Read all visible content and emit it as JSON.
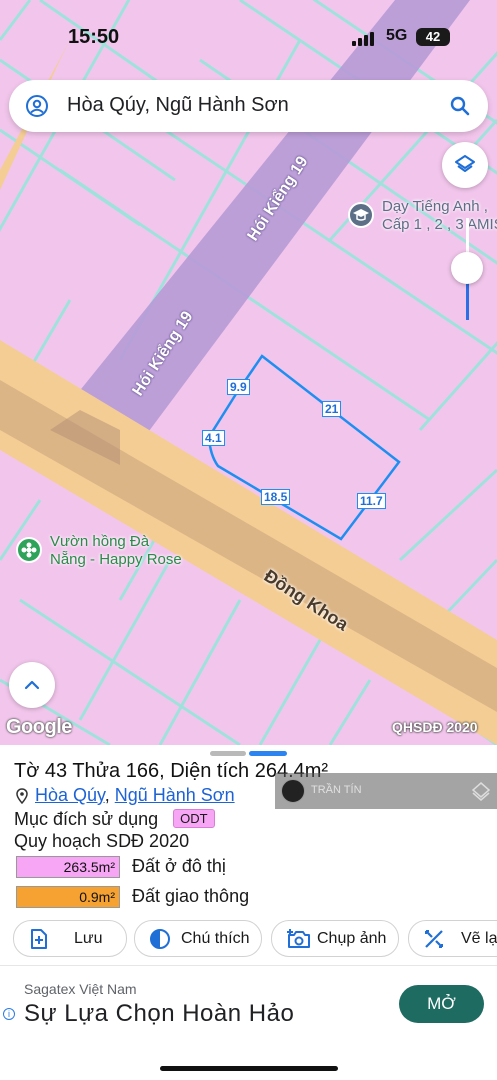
{
  "status_bar": {
    "time": "15:50",
    "network": "5G",
    "battery": "42"
  },
  "search": {
    "query": "Hòa Qúy, Ngũ Hành Sơn",
    "left_icon": "person-circle-icon",
    "right_icon": "search-icon"
  },
  "map": {
    "street_labels": [
      "Hói Kiểng 19",
      "Hói Kiểng 19",
      "Đồng Khoa"
    ],
    "segment_lengths": [
      "9.9",
      "21",
      "4.1",
      "18.5",
      "11.7"
    ],
    "pois": [
      {
        "name_line1": "Dạy Tiếng Anh ,",
        "name_line2": "Cấp 1 , 2 , 3 AMIS",
        "icon": "school-icon"
      },
      {
        "name_line1": "Vườn hồng Đà",
        "name_line2": "Nẵng - Happy Rose",
        "icon": "flower-icon"
      }
    ],
    "google_logo": "Google",
    "source_label": "QHSDĐ 2020",
    "colors": {
      "residential": "#f2c6ec",
      "traffic_road": "#f4cd95",
      "parcel_outline": "#1f8ef1",
      "lot_lines": "#9fe2dc"
    },
    "opacity_slider_value": 0.6
  },
  "parcel": {
    "title": "Tờ 43 Thửa 166, Diện tích 264.4m²",
    "ward": "Hòa Qúy",
    "separator": ",",
    "district": "Ngũ Hành Sơn",
    "purpose_label": "Mục đích sử dụng",
    "purpose_code": "ODT",
    "plan_title": "Quy hoạch SDĐ 2020",
    "land_use": [
      {
        "area": "263.5m²",
        "label": "Đất ở đô thị",
        "color": "#f7a6f5"
      },
      {
        "area": "0.9m²",
        "label": "Đất giao thông",
        "color": "#f5a233"
      }
    ]
  },
  "watermark": {
    "name": "TRẦN TÍN"
  },
  "actions": [
    {
      "label": "Lưu",
      "icon": "save-add-icon"
    },
    {
      "label": "Chú thích",
      "icon": "legend-icon"
    },
    {
      "label": "Chụp ảnh",
      "icon": "camera-add-icon"
    },
    {
      "label": "Vẽ lạ",
      "icon": "draw-icon"
    }
  ],
  "ad": {
    "advertiser": "Sagatex Việt Nam",
    "headline": "Sự Lựa Chọn Hoàn Hảo",
    "cta": "MỞ"
  }
}
